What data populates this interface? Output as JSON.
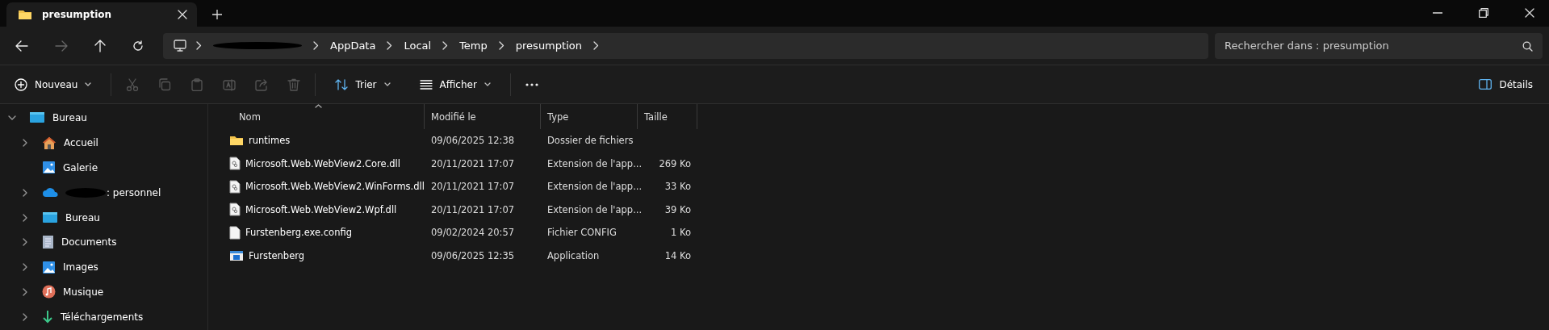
{
  "tabs": [
    {
      "title": "presumption",
      "selected": true
    }
  ],
  "breadcrumb": {
    "segments": [
      {
        "kind": "redacted"
      },
      {
        "kind": "folder",
        "label": "AppData"
      },
      {
        "kind": "folder",
        "label": "Local"
      },
      {
        "kind": "folder",
        "label": "Temp"
      },
      {
        "kind": "folder",
        "label": "presumption"
      }
    ]
  },
  "search": {
    "placeholder": "Rechercher dans : presumption"
  },
  "nav": {
    "back_disabled": false,
    "forward_disabled": true
  },
  "toolbar": {
    "new_label": "Nouveau",
    "actions": [
      {
        "kind": "cut",
        "disabled": true
      },
      {
        "kind": "copy",
        "disabled": true
      },
      {
        "kind": "paste",
        "disabled": true
      },
      {
        "kind": "rename",
        "disabled": true
      },
      {
        "kind": "share",
        "disabled": true
      },
      {
        "kind": "delete",
        "disabled": true
      }
    ],
    "sort_label": "Trier",
    "view_label": "Afficher",
    "details_label": "Détails"
  },
  "sidebar": {
    "items": [
      {
        "label": "Bureau",
        "kind": "desktop",
        "expanded": true,
        "children": [
          {
            "label": "Accueil",
            "kind": "home",
            "expandable": true
          },
          {
            "label": "Galerie",
            "kind": "gallery",
            "expandable": false
          },
          {
            "label": ": personnel",
            "kind": "cloud",
            "expandable": true
          },
          {
            "label": "Bureau",
            "kind": "desktop",
            "expandable": true
          },
          {
            "label": "Documents",
            "kind": "documents",
            "expandable": true
          },
          {
            "label": "Images",
            "kind": "gallery",
            "expandable": true
          },
          {
            "label": "Musique",
            "kind": "music",
            "expandable": true
          },
          {
            "label": "Téléchargements",
            "kind": "download",
            "expandable": true
          }
        ]
      }
    ]
  },
  "table": {
    "columns": [
      {
        "label": "Nom",
        "sorted": true
      },
      {
        "label": "Modifié le",
        "sorted": false
      },
      {
        "label": "Type",
        "sorted": false
      },
      {
        "label": "Taille",
        "sorted": false
      }
    ],
    "rows": [
      {
        "kind": "folder",
        "name": "runtimes",
        "modified": "09/06/2025 12:38",
        "type": "Dossier de fichiers",
        "size": ""
      },
      {
        "kind": "dll",
        "name": "Microsoft.Web.WebView2.Core.dll",
        "modified": "20/11/2021 17:07",
        "type": "Extension de l'app...",
        "size": "269 Ko"
      },
      {
        "kind": "dll",
        "name": "Microsoft.Web.WebView2.WinForms.dll",
        "modified": "20/11/2021 17:07",
        "type": "Extension de l'app...",
        "size": "33 Ko"
      },
      {
        "kind": "dll",
        "name": "Microsoft.Web.WebView2.Wpf.dll",
        "modified": "20/11/2021 17:07",
        "type": "Extension de l'app...",
        "size": "39 Ko"
      },
      {
        "kind": "config",
        "name": "Furstenberg.exe.config",
        "modified": "09/02/2024 20:57",
        "type": "Fichier CONFIG",
        "size": "1 Ko"
      },
      {
        "kind": "app",
        "name": "Furstenberg",
        "modified": "09/06/2025 12:35",
        "type": "Application",
        "size": "14 Ko"
      }
    ]
  }
}
